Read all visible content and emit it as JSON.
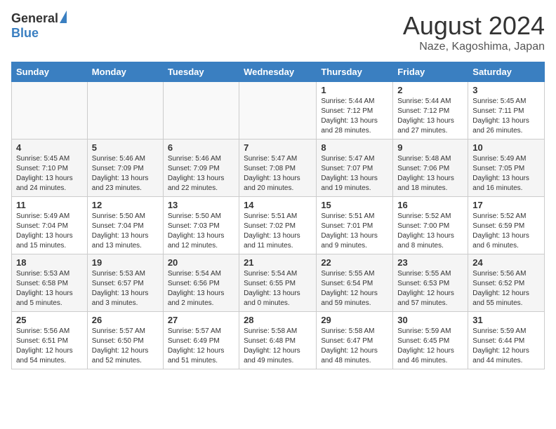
{
  "logo": {
    "general": "General",
    "blue": "Blue"
  },
  "title": "August 2024",
  "location": "Naze, Kagoshima, Japan",
  "days_of_week": [
    "Sunday",
    "Monday",
    "Tuesday",
    "Wednesday",
    "Thursday",
    "Friday",
    "Saturday"
  ],
  "weeks": [
    [
      {
        "day": "",
        "detail": ""
      },
      {
        "day": "",
        "detail": ""
      },
      {
        "day": "",
        "detail": ""
      },
      {
        "day": "",
        "detail": ""
      },
      {
        "day": "1",
        "detail": "Sunrise: 5:44 AM\nSunset: 7:12 PM\nDaylight: 13 hours\nand 28 minutes."
      },
      {
        "day": "2",
        "detail": "Sunrise: 5:44 AM\nSunset: 7:12 PM\nDaylight: 13 hours\nand 27 minutes."
      },
      {
        "day": "3",
        "detail": "Sunrise: 5:45 AM\nSunset: 7:11 PM\nDaylight: 13 hours\nand 26 minutes."
      }
    ],
    [
      {
        "day": "4",
        "detail": "Sunrise: 5:45 AM\nSunset: 7:10 PM\nDaylight: 13 hours\nand 24 minutes."
      },
      {
        "day": "5",
        "detail": "Sunrise: 5:46 AM\nSunset: 7:09 PM\nDaylight: 13 hours\nand 23 minutes."
      },
      {
        "day": "6",
        "detail": "Sunrise: 5:46 AM\nSunset: 7:09 PM\nDaylight: 13 hours\nand 22 minutes."
      },
      {
        "day": "7",
        "detail": "Sunrise: 5:47 AM\nSunset: 7:08 PM\nDaylight: 13 hours\nand 20 minutes."
      },
      {
        "day": "8",
        "detail": "Sunrise: 5:47 AM\nSunset: 7:07 PM\nDaylight: 13 hours\nand 19 minutes."
      },
      {
        "day": "9",
        "detail": "Sunrise: 5:48 AM\nSunset: 7:06 PM\nDaylight: 13 hours\nand 18 minutes."
      },
      {
        "day": "10",
        "detail": "Sunrise: 5:49 AM\nSunset: 7:05 PM\nDaylight: 13 hours\nand 16 minutes."
      }
    ],
    [
      {
        "day": "11",
        "detail": "Sunrise: 5:49 AM\nSunset: 7:04 PM\nDaylight: 13 hours\nand 15 minutes."
      },
      {
        "day": "12",
        "detail": "Sunrise: 5:50 AM\nSunset: 7:04 PM\nDaylight: 13 hours\nand 13 minutes."
      },
      {
        "day": "13",
        "detail": "Sunrise: 5:50 AM\nSunset: 7:03 PM\nDaylight: 13 hours\nand 12 minutes."
      },
      {
        "day": "14",
        "detail": "Sunrise: 5:51 AM\nSunset: 7:02 PM\nDaylight: 13 hours\nand 11 minutes."
      },
      {
        "day": "15",
        "detail": "Sunrise: 5:51 AM\nSunset: 7:01 PM\nDaylight: 13 hours\nand 9 minutes."
      },
      {
        "day": "16",
        "detail": "Sunrise: 5:52 AM\nSunset: 7:00 PM\nDaylight: 13 hours\nand 8 minutes."
      },
      {
        "day": "17",
        "detail": "Sunrise: 5:52 AM\nSunset: 6:59 PM\nDaylight: 13 hours\nand 6 minutes."
      }
    ],
    [
      {
        "day": "18",
        "detail": "Sunrise: 5:53 AM\nSunset: 6:58 PM\nDaylight: 13 hours\nand 5 minutes."
      },
      {
        "day": "19",
        "detail": "Sunrise: 5:53 AM\nSunset: 6:57 PM\nDaylight: 13 hours\nand 3 minutes."
      },
      {
        "day": "20",
        "detail": "Sunrise: 5:54 AM\nSunset: 6:56 PM\nDaylight: 13 hours\nand 2 minutes."
      },
      {
        "day": "21",
        "detail": "Sunrise: 5:54 AM\nSunset: 6:55 PM\nDaylight: 13 hours\nand 0 minutes."
      },
      {
        "day": "22",
        "detail": "Sunrise: 5:55 AM\nSunset: 6:54 PM\nDaylight: 12 hours\nand 59 minutes."
      },
      {
        "day": "23",
        "detail": "Sunrise: 5:55 AM\nSunset: 6:53 PM\nDaylight: 12 hours\nand 57 minutes."
      },
      {
        "day": "24",
        "detail": "Sunrise: 5:56 AM\nSunset: 6:52 PM\nDaylight: 12 hours\nand 55 minutes."
      }
    ],
    [
      {
        "day": "25",
        "detail": "Sunrise: 5:56 AM\nSunset: 6:51 PM\nDaylight: 12 hours\nand 54 minutes."
      },
      {
        "day": "26",
        "detail": "Sunrise: 5:57 AM\nSunset: 6:50 PM\nDaylight: 12 hours\nand 52 minutes."
      },
      {
        "day": "27",
        "detail": "Sunrise: 5:57 AM\nSunset: 6:49 PM\nDaylight: 12 hours\nand 51 minutes."
      },
      {
        "day": "28",
        "detail": "Sunrise: 5:58 AM\nSunset: 6:48 PM\nDaylight: 12 hours\nand 49 minutes."
      },
      {
        "day": "29",
        "detail": "Sunrise: 5:58 AM\nSunset: 6:47 PM\nDaylight: 12 hours\nand 48 minutes."
      },
      {
        "day": "30",
        "detail": "Sunrise: 5:59 AM\nSunset: 6:45 PM\nDaylight: 12 hours\nand 46 minutes."
      },
      {
        "day": "31",
        "detail": "Sunrise: 5:59 AM\nSunset: 6:44 PM\nDaylight: 12 hours\nand 44 minutes."
      }
    ]
  ]
}
